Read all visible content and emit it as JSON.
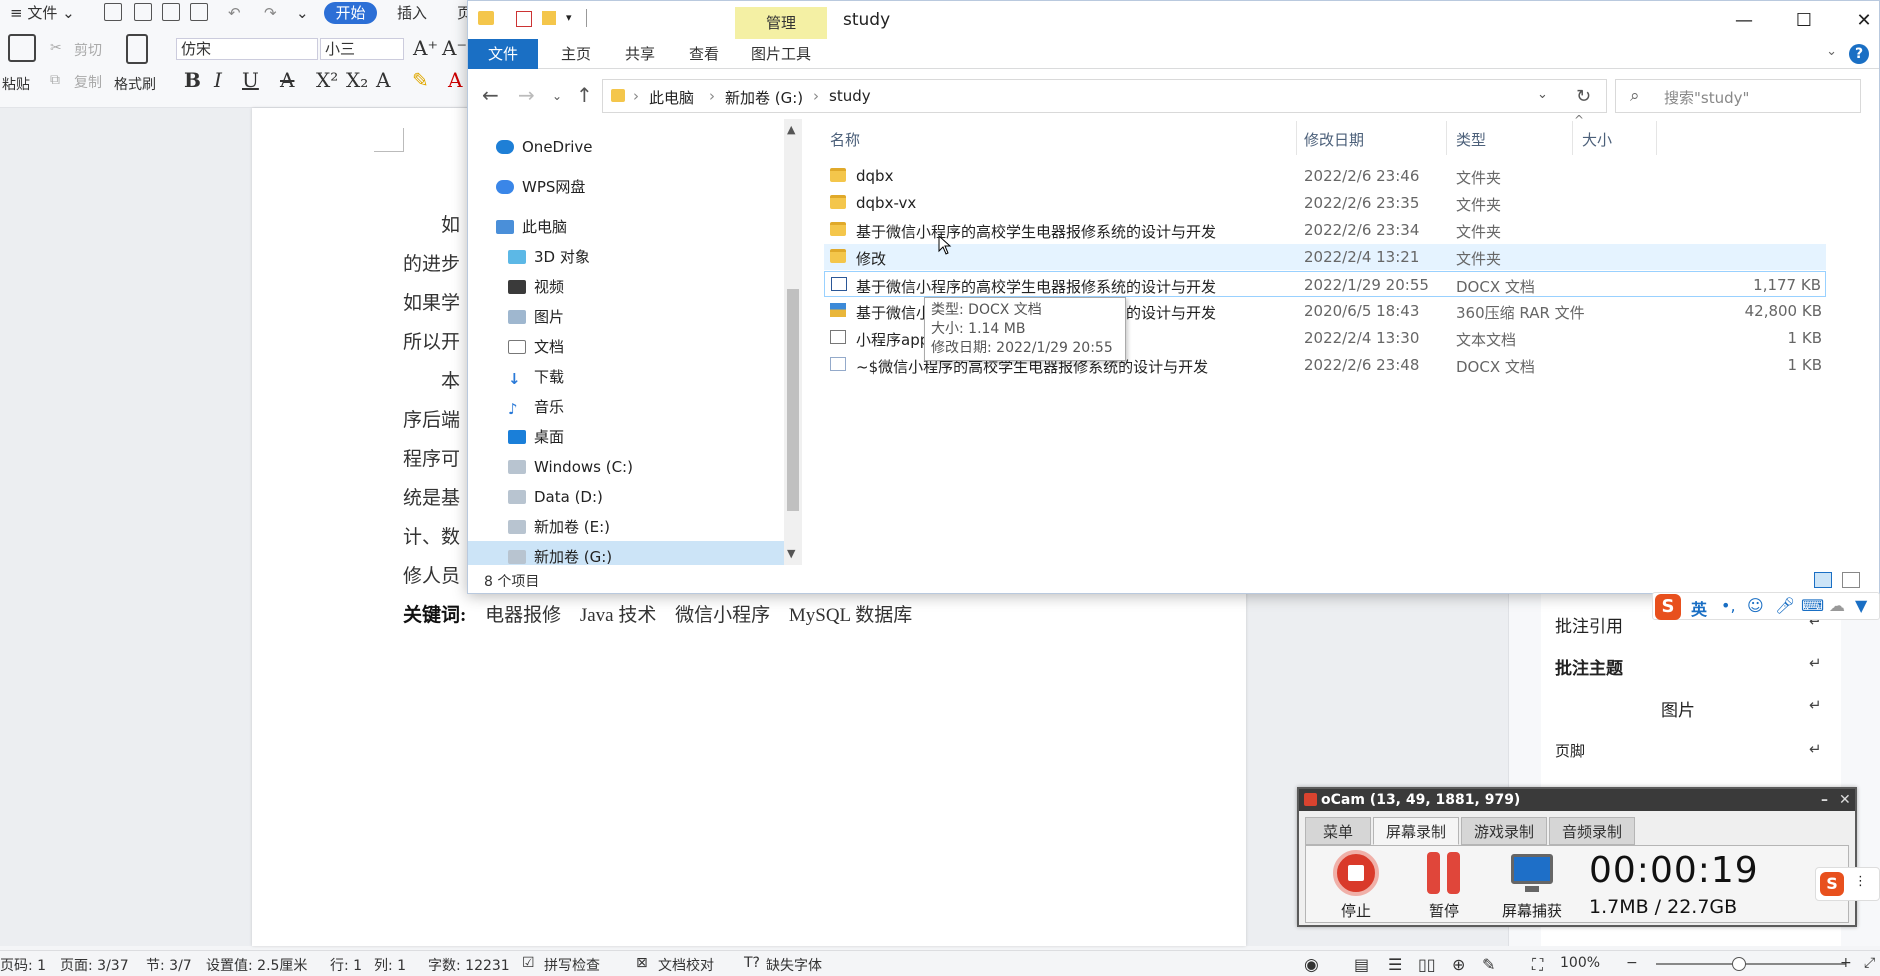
{
  "wps": {
    "menu": {
      "file": "文件",
      "home": "开始",
      "insert": "插入",
      "more": "页"
    },
    "ribbon": {
      "paste": "粘贴",
      "cut": "剪切",
      "copy": "复制",
      "format_painter": "格式刷",
      "font_name": "仿宋",
      "font_size": "小三"
    },
    "doc_lines": [
      "如",
      "的进步",
      "如果学",
      "所以开",
      "本",
      "序后端",
      "程序可",
      "统是基",
      "计、数",
      "修人员"
    ],
    "keywords": {
      "label": "关键词:",
      "items": [
        "电器报修",
        "Java 技术",
        "微信小程序",
        "MySQL 数据库"
      ]
    },
    "right_pane": {
      "items": [
        "批注引用",
        "批注主题",
        "图片",
        "页脚"
      ]
    },
    "statusbar": {
      "page_code": "页码: 1",
      "page": "页面: 3/37",
      "section": "节: 3/7",
      "setting": "设置值: 2.5厘米",
      "row": "行: 1",
      "col": "列: 1",
      "words": "字数: 12231",
      "spellcheck": "拼写检查",
      "doc_check": "文档校对",
      "missing_font": "缺失字体",
      "zoom": "100%"
    }
  },
  "explorer": {
    "title": "study",
    "manage_tab": "管理",
    "tabs": [
      "文件",
      "主页",
      "共享",
      "查看",
      "图片工具"
    ],
    "breadcrumb": [
      "此电脑",
      "新加卷 (G:)",
      "study"
    ],
    "search_placeholder": "搜索\"study\"",
    "nav": [
      {
        "label": "OneDrive",
        "icon": "cloud-icon"
      },
      {
        "label": "WPS网盘",
        "icon": "cloud-icon"
      },
      {
        "label": "此电脑",
        "icon": "computer-icon"
      },
      {
        "label": "3D 对象",
        "icon": "cube-icon"
      },
      {
        "label": "视频",
        "icon": "video-icon"
      },
      {
        "label": "图片",
        "icon": "picture-icon"
      },
      {
        "label": "文档",
        "icon": "document-icon"
      },
      {
        "label": "下载",
        "icon": "download-icon"
      },
      {
        "label": "音乐",
        "icon": "music-icon"
      },
      {
        "label": "桌面",
        "icon": "desktop-icon"
      },
      {
        "label": "Windows (C:)",
        "icon": "drive-icon"
      },
      {
        "label": "Data (D:)",
        "icon": "drive-icon"
      },
      {
        "label": "新加卷 (E:)",
        "icon": "drive-icon"
      },
      {
        "label": "新加卷 (G:)",
        "icon": "drive-icon"
      }
    ],
    "columns": {
      "name": "名称",
      "date": "修改日期",
      "type": "类型",
      "size": "大小"
    },
    "files": [
      {
        "name": "dqbx",
        "date": "2022/2/6 23:46",
        "type": "文件夹",
        "size": ""
      },
      {
        "name": "dqbx-vx",
        "date": "2022/2/6 23:35",
        "type": "文件夹",
        "size": ""
      },
      {
        "name": "基于微信小程序的高校学生电器报修系统的设计与开发",
        "date": "2022/2/6 23:34",
        "type": "文件夹",
        "size": ""
      },
      {
        "name": "修改",
        "date": "2022/2/4 13:21",
        "type": "文件夹",
        "size": ""
      },
      {
        "name": "基于微信小程序的高校学生电器报修系统的设计与开发",
        "date": "2022/1/29 20:55",
        "type": "DOCX 文档",
        "size": "1,177 KB"
      },
      {
        "name": "基于微信小程序的高校学生电器报修系统的设计与开发",
        "date": "2020/6/5 18:43",
        "type": "360压缩 RAR 文件",
        "size": "42,800 KB"
      },
      {
        "name": "小程序app",
        "date": "2022/2/4 13:30",
        "type": "文本文档",
        "size": "1 KB"
      },
      {
        "name": "~$微信小程序的高校学生电器报修系统的设计与开发",
        "date": "2022/2/6 23:48",
        "type": "DOCX 文档",
        "size": "1 KB"
      }
    ],
    "tooltip": {
      "type": "类型: DOCX 文档",
      "size": "大小: 1.14 MB",
      "date": "修改日期: 2022/1/29 20:55"
    },
    "item_count": "8 个项目"
  },
  "ocam": {
    "title": "oCam (13, 49, 1881, 979)",
    "tabs": [
      "菜单",
      "屏幕录制",
      "游戏录制",
      "音频录制"
    ],
    "stop": "停止",
    "pause": "暂停",
    "capture": "屏幕捕获",
    "timer": "00:00:19",
    "size": "1.7MB / 22.7GB"
  },
  "ime": {
    "mode": "英"
  }
}
